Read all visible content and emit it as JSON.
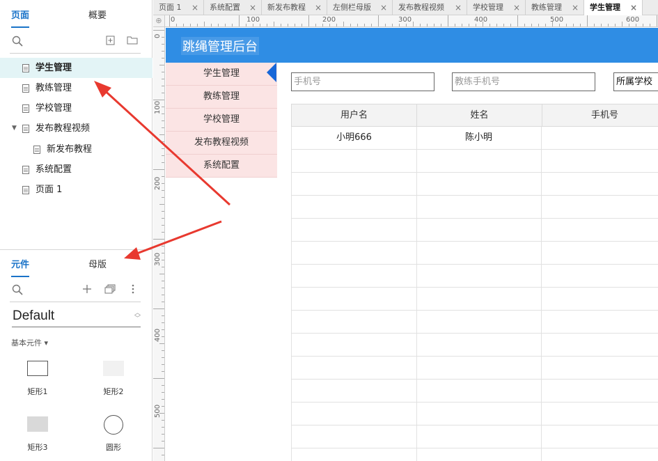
{
  "pages_panel": {
    "tabs": [
      "页面",
      "概要"
    ],
    "items": [
      {
        "label": "学生管理",
        "selected": true
      },
      {
        "label": "教练管理"
      },
      {
        "label": "学校管理"
      },
      {
        "label": "发布教程视频",
        "expanded": true
      },
      {
        "label": "新发布教程",
        "child": true
      },
      {
        "label": "系统配置"
      },
      {
        "label": "页面 1"
      }
    ]
  },
  "library_panel": {
    "tabs": [
      "元件",
      "母版"
    ],
    "library": "Default",
    "section": "基本元件 ▾",
    "widgets": [
      "矩形1",
      "矩形2",
      "矩形3",
      "圆形"
    ]
  },
  "doc_tabs": [
    "页面 1",
    "系统配置",
    "新发布教程",
    "左侧栏母版",
    "发布教程视频",
    "学校管理",
    "教练管理",
    "学生管理"
  ],
  "ruler": {
    "h_labels": [
      "0",
      "100",
      "200",
      "300",
      "400",
      "500",
      "600"
    ],
    "v_labels": [
      "0",
      "100",
      "200",
      "300",
      "400",
      "500"
    ]
  },
  "app": {
    "title": "跳绳管理后台",
    "menu": [
      "学生管理",
      "教练管理",
      "学校管理",
      "发布教程视频",
      "系统配置"
    ],
    "filters": {
      "phone_placeholder": "手机号",
      "coach_phone_placeholder": "教练手机号",
      "school_select": "所属学校"
    },
    "table": {
      "columns": [
        "用户名",
        "姓名",
        "手机号"
      ],
      "rows": [
        [
          "小明666",
          "陈小明",
          ""
        ]
      ]
    }
  },
  "colors": {
    "header_bg": "#2f8de4",
    "menu_bg": "#fbe4e4",
    "accent": "#1a73c8",
    "annotation_arrow": "#e8392f"
  }
}
